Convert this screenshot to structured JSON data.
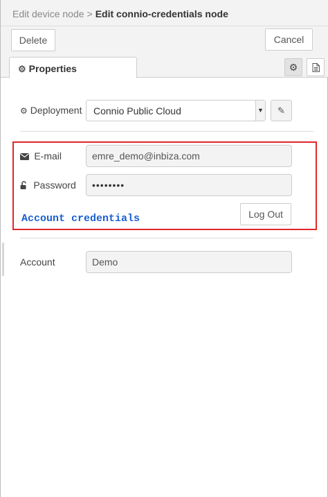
{
  "header": {
    "parent_crumb": "Edit device node",
    "separator": ">",
    "current": "Edit connio-credentials node"
  },
  "toolbar": {
    "delete_label": "Delete",
    "cancel_label": "Cancel"
  },
  "tabs": {
    "properties_label": "Properties",
    "settings_icon": "gear-icon",
    "description_icon": "document-icon"
  },
  "form": {
    "deployment": {
      "label": "Deployment",
      "icon": "gear-icon",
      "value": "Connio Public Cloud"
    },
    "email": {
      "label": "E-mail",
      "icon": "envelope-icon",
      "value": "emre_demo@inbiza.com"
    },
    "password": {
      "label": "Password",
      "icon": "unlock-icon",
      "value": "••••••••"
    },
    "logout_label": "Log Out",
    "annotation": "Account credentials",
    "annotation_color": "#1a5fd0",
    "highlight_color": "#e0262a",
    "account": {
      "label": "Account",
      "value": "Demo"
    }
  }
}
